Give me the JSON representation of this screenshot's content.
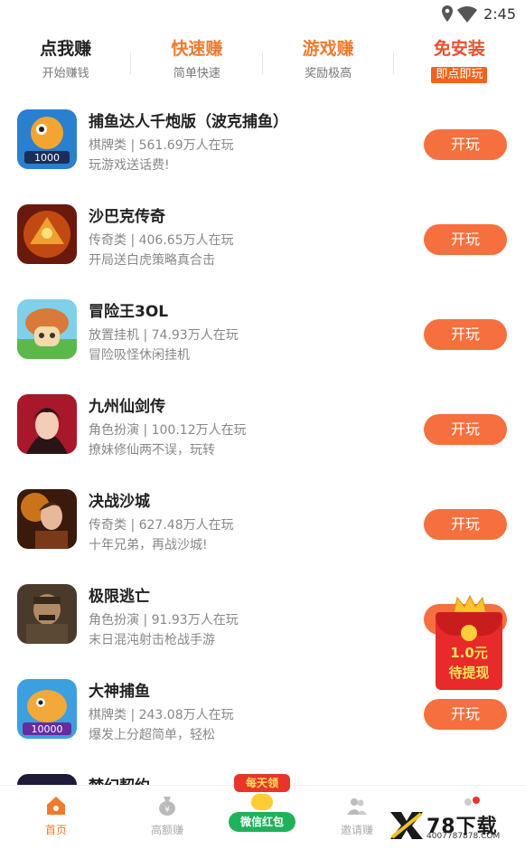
{
  "status_bar": {
    "time": "2:45",
    "icons": [
      "location-icon",
      "wifi-icon"
    ]
  },
  "tabs": [
    {
      "title": "点我赚",
      "sub": "开始赚钱"
    },
    {
      "title": "快速赚",
      "sub": "简单快速"
    },
    {
      "title": "游戏赚",
      "sub": "奖励极高"
    },
    {
      "title": "免安装",
      "sub": "即点即玩"
    }
  ],
  "games": [
    {
      "name": "捕鱼达人千炮版（波克捕鱼）",
      "meta": "棋牌类 | 561.69万人在玩",
      "desc": "玩游戏送话费!",
      "button": "开玩"
    },
    {
      "name": "沙巴克传奇",
      "meta": "传奇类 | 406.65万人在玩",
      "desc": "开局送白虎策略真合击",
      "button": "开玩"
    },
    {
      "name": "冒险王3OL",
      "meta": "放置挂机 | 74.93万人在玩",
      "desc": "冒险吸怪休闲挂机",
      "button": "开玩"
    },
    {
      "name": "九州仙剑传",
      "meta": "角色扮演 | 100.12万人在玩",
      "desc": "撩妹修仙两不误，玩转",
      "button": "开玩"
    },
    {
      "name": "决战沙城",
      "meta": "传奇类 | 627.48万人在玩",
      "desc": "十年兄弟，再战沙城!",
      "button": "开玩"
    },
    {
      "name": "极限逃亡",
      "meta": "角色扮演 | 91.93万人在玩",
      "desc": "末日混沌射击枪战手游",
      "button": "开玩"
    },
    {
      "name": "大神捕鱼",
      "meta": "棋牌类 | 243.08万人在玩",
      "desc": "爆发上分超简单，轻松",
      "button": "开玩"
    },
    {
      "name": "梦幻契约",
      "meta": "",
      "desc": "",
      "button": ""
    }
  ],
  "red_packet": {
    "amount": "1.0元",
    "label": "待提现"
  },
  "bottom_nav": {
    "home": "首页",
    "high_earn": "高额赚",
    "center_top": "每天领",
    "center_label": "微信红包",
    "invite": "邀请赚"
  },
  "watermark": {
    "text": "78下载",
    "url": "4007787878.COM"
  },
  "colors": {
    "accent": "#f07a2e",
    "button": "#f5703e",
    "wechat_green": "#21b15a",
    "packet_red": "#e82a2a"
  }
}
